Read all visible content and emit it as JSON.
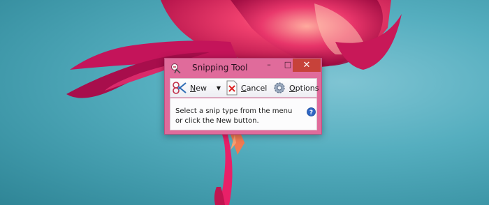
{
  "window": {
    "title": "Snipping Tool",
    "minimize_glyph": "–",
    "maximize_glyph": "□",
    "close_glyph": "✕"
  },
  "toolbar": {
    "new_label_underlined": "N",
    "new_label_rest": "ew",
    "dropdown_glyph": "▼",
    "cancel_label_underlined": "C",
    "cancel_label_rest": "ancel",
    "options_label_underlined": "O",
    "options_label_rest": "ptions"
  },
  "content": {
    "message_line1": "Select a snip type from the menu",
    "message_line2": "or click the New button.",
    "help_glyph": "?"
  },
  "icons": {
    "app": "snipping-tool-icon",
    "new": "scissors-icon",
    "cancel": "cancel-x-icon",
    "options": "gear-icon",
    "help": "help-icon"
  },
  "colors": {
    "window_frame": "#e06b9b",
    "close_button": "#c7423a",
    "desktop_teal": "#55aebf",
    "flower_pink": "#e0205f"
  }
}
